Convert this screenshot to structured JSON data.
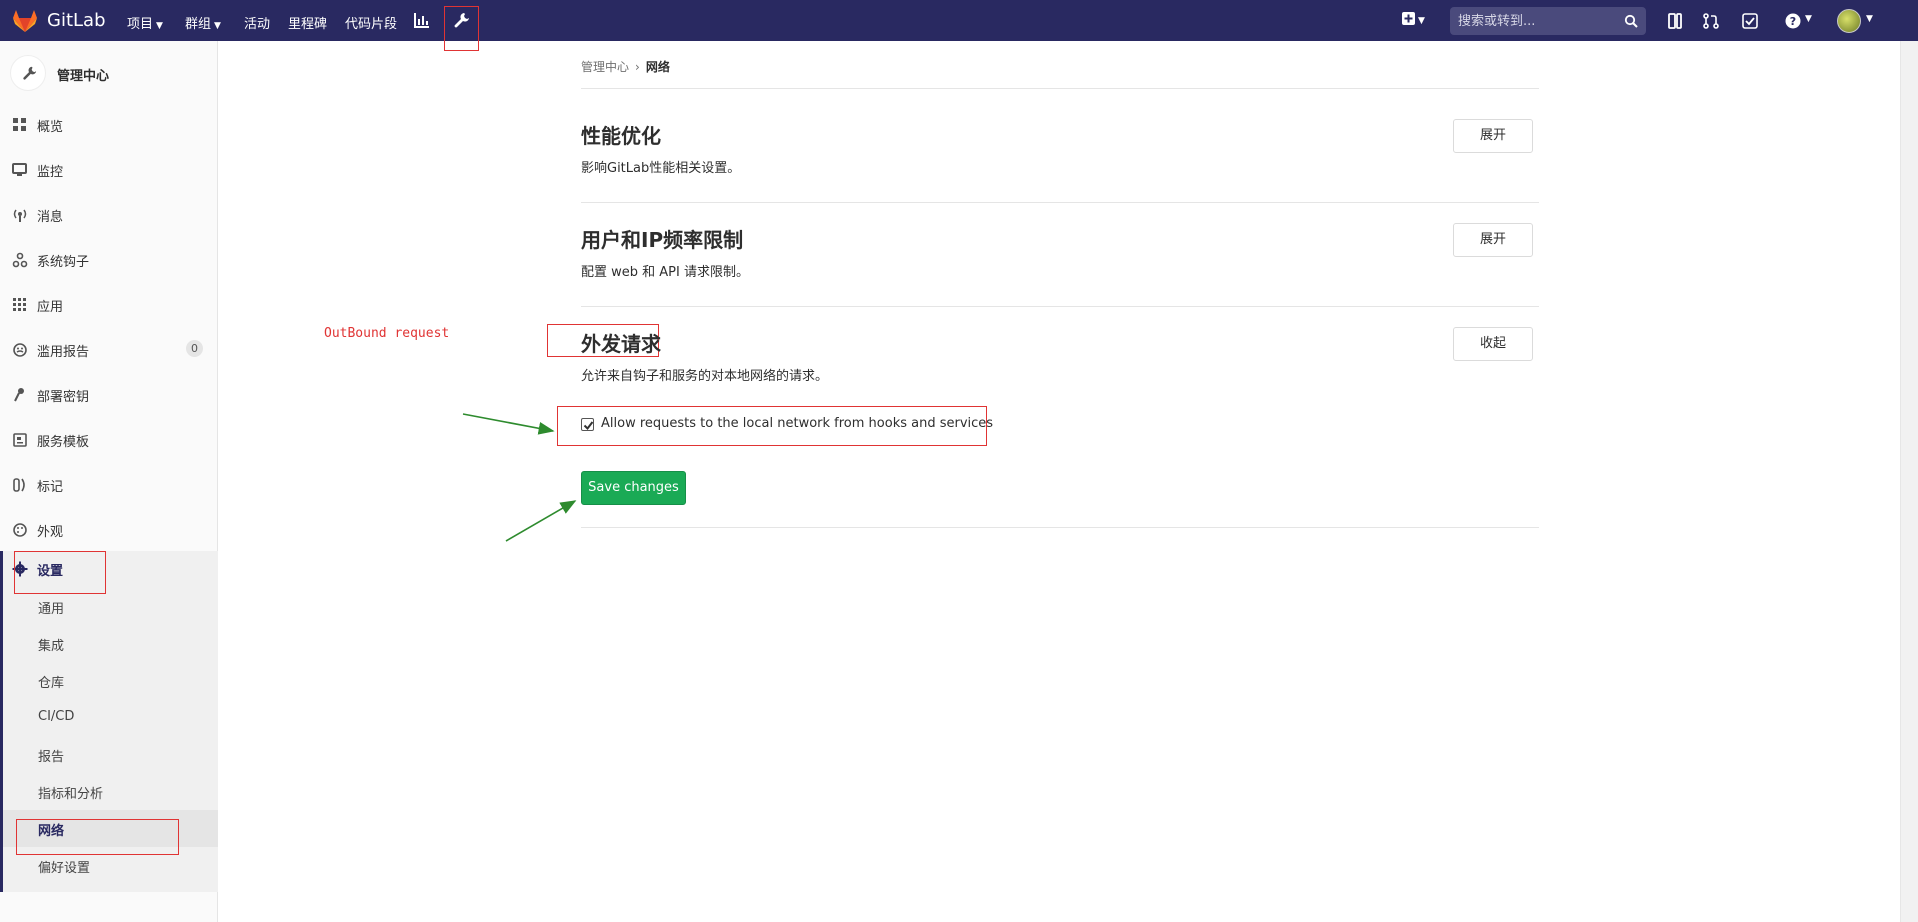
{
  "navbar": {
    "brand": "GitLab",
    "items": [
      {
        "label": "项目"
      },
      {
        "label": "群组"
      },
      {
        "label": "活动"
      },
      {
        "label": "里程碑"
      },
      {
        "label": "代码片段"
      }
    ],
    "search_placeholder": "搜索或转到...",
    "colors": {
      "bg": "#292961",
      "accent": "#fc6d26"
    }
  },
  "sidebar": {
    "title": "管理中心",
    "items": [
      {
        "label": "概览",
        "icon": "grid-icon"
      },
      {
        "label": "监控",
        "icon": "monitor-icon"
      },
      {
        "label": "消息",
        "icon": "broadcast-icon"
      },
      {
        "label": "系统钩子",
        "icon": "hook-icon"
      },
      {
        "label": "应用",
        "icon": "apps-icon"
      },
      {
        "label": "滥用报告",
        "icon": "smile-icon",
        "badge": "0"
      },
      {
        "label": "部署密钥",
        "icon": "key-icon"
      },
      {
        "label": "服务模板",
        "icon": "template-icon"
      },
      {
        "label": "标记",
        "icon": "labels-icon"
      },
      {
        "label": "外观",
        "icon": "palette-icon"
      },
      {
        "label": "设置",
        "icon": "gear-icon"
      }
    ],
    "settings_sub": [
      {
        "label": "通用"
      },
      {
        "label": "集成"
      },
      {
        "label": "仓库"
      },
      {
        "label": "CI/CD"
      },
      {
        "label": "报告"
      },
      {
        "label": "指标和分析"
      },
      {
        "label": "网络"
      },
      {
        "label": "偏好设置"
      }
    ]
  },
  "breadcrumb": {
    "parent": "管理中心",
    "current": "网络"
  },
  "sections": [
    {
      "title": "性能优化",
      "desc": "影响GitLab性能相关设置。",
      "button": "展开"
    },
    {
      "title": "用户和IP频率限制",
      "desc": "配置 web 和 API 请求限制。",
      "button": "展开"
    },
    {
      "title": "外发请求",
      "desc": "允许来自钩子和服务的对本地网络的请求。",
      "button": "收起"
    }
  ],
  "outbound": {
    "checkbox_label": "Allow requests to the local network from hooks and services",
    "checked": true,
    "save_label": "Save changes"
  },
  "annotation": {
    "text": "OutBound request",
    "color": "#e03434"
  }
}
